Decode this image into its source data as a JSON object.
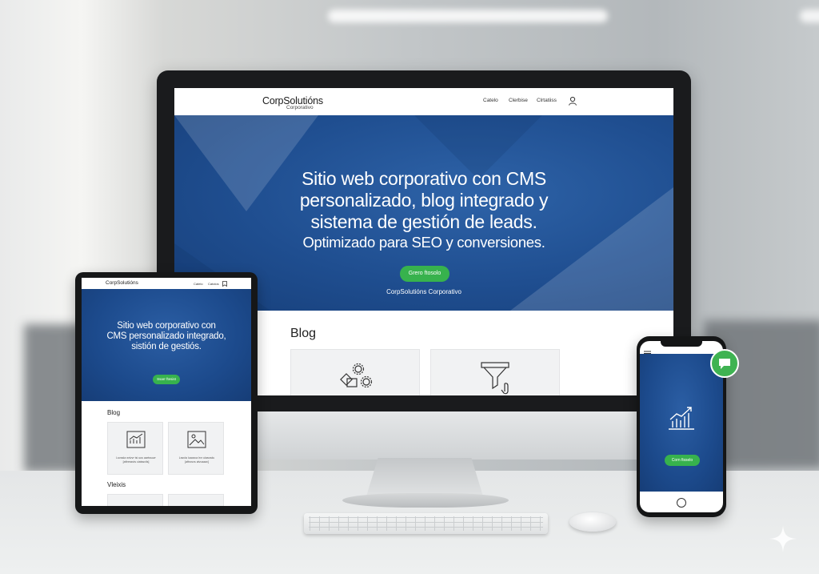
{
  "desktop": {
    "logo": "CorpSolutións",
    "logo_sub": "Corporativo",
    "nav": [
      "Catelo",
      "Clerbise",
      "Clrtatiiss"
    ],
    "headline_lines": [
      "Sitio web corporativo con CMS",
      "personalizado, blog integrado y",
      "sistema de gestión de leads."
    ],
    "subheadline": "Optimizado para SEO y conversiones.",
    "cta": "Grero ftosolo",
    "hero_footer": "CorpSolutións Corporativo",
    "blog_title": "Blog"
  },
  "tablet": {
    "logo": "CorpSolutións",
    "nav": [
      "Catelo",
      "Catolos"
    ],
    "headline_lines": [
      "Sitio web corporativo con",
      "CMS personalizado integrado,",
      "sistión de gestiós."
    ],
    "cta": "Ssarr ftesist",
    "blog_title": "Blog",
    "card_captions": [
      "Lsvssla wrivvr tsi uus aartssuvr\n[aftressvts ciatssvils]",
      "Lssvla luacsva lrvr ulasvsdu\n[aftrosvs alvvaaav]"
    ],
    "videos_title": "Vleixis"
  },
  "phone": {
    "cta": "Corn fisselo"
  },
  "colors": {
    "hero_blue": "#1f4e90",
    "cta_green": "#37b24d"
  }
}
